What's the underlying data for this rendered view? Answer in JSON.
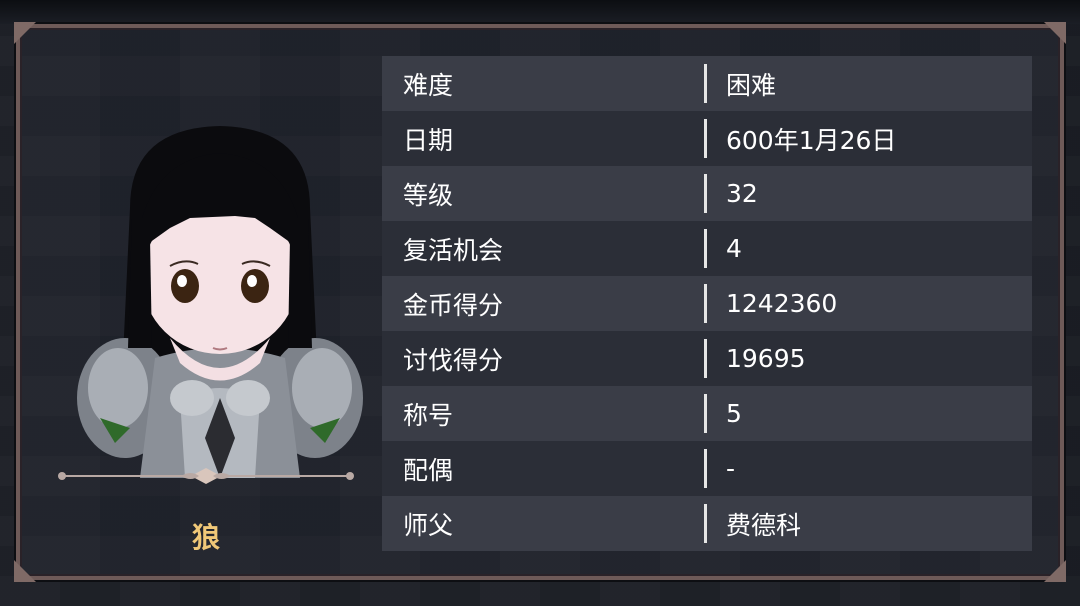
{
  "character": {
    "name": "狼"
  },
  "stats": [
    {
      "label": "难度",
      "value": "困难"
    },
    {
      "label": "日期",
      "value": "600年1月26日"
    },
    {
      "label": "等级",
      "value": "32"
    },
    {
      "label": "复活机会",
      "value": "4"
    },
    {
      "label": "金币得分",
      "value": "1242360"
    },
    {
      "label": "讨伐得分",
      "value": "19695"
    },
    {
      "label": "称号",
      "value": "5"
    },
    {
      "label": "配偶",
      "value": "-"
    },
    {
      "label": "师父",
      "value": "费德科"
    }
  ],
  "colors": {
    "name_accent": "#f0c878",
    "frame": "#6e5a58",
    "row_light": "#3a3d47",
    "row_dark": "#2b2e37"
  },
  "icons": {
    "portrait": "chibi-armored-girl-portrait",
    "divider": "ornamental-divider-icon"
  }
}
